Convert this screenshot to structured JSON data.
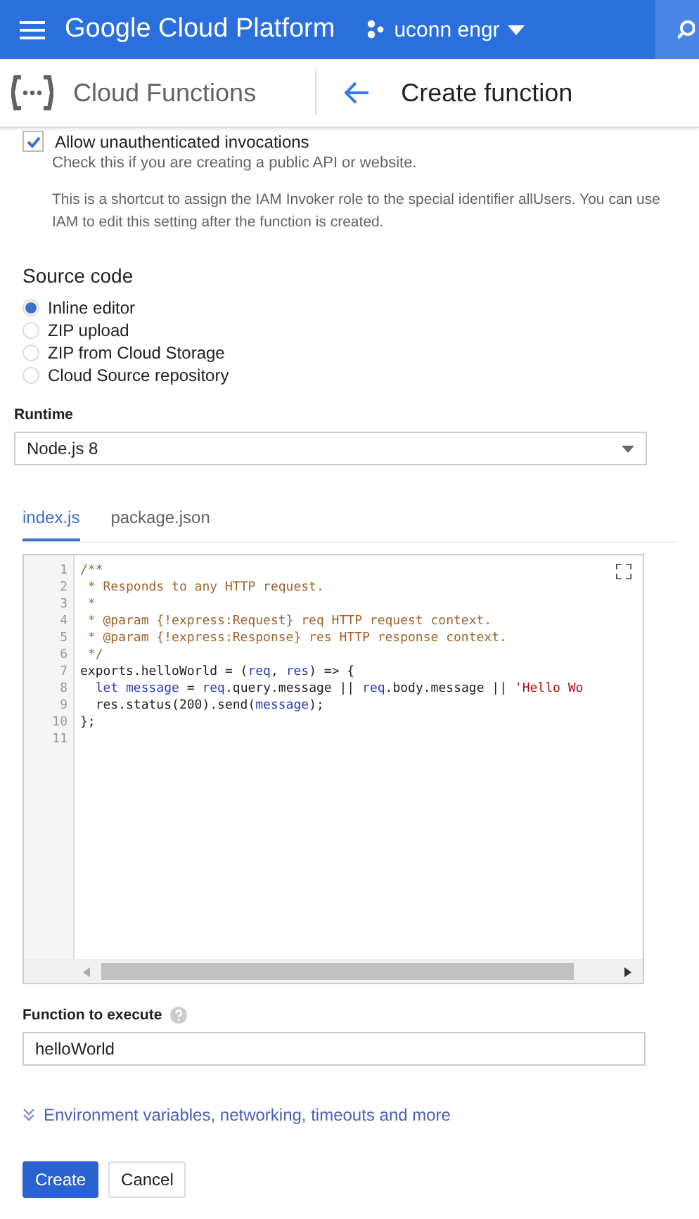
{
  "top_bar": {
    "title": "Google Cloud Platform",
    "project": "uconn engr"
  },
  "sub_header": {
    "product": "Cloud Functions",
    "page_title": "Create function"
  },
  "auth": {
    "label": "Allow unauthenticated invocations",
    "checked": true,
    "hint": "Check this if you are creating a public API or website.",
    "note": "This is a shortcut to assign the IAM Invoker role to the special identifier allUsers. You can use IAM to edit this setting after the function is created."
  },
  "source_code": {
    "title": "Source code",
    "options": [
      {
        "label": "Inline editor",
        "selected": true
      },
      {
        "label": "ZIP upload",
        "selected": false
      },
      {
        "label": "ZIP from Cloud Storage",
        "selected": false
      },
      {
        "label": "Cloud Source repository",
        "selected": false
      }
    ]
  },
  "runtime": {
    "label": "Runtime",
    "value": "Node.js 8"
  },
  "file_tabs": [
    {
      "label": "index.js",
      "selected": true
    },
    {
      "label": "package.json",
      "selected": false
    }
  ],
  "editor": {
    "lines": [
      {
        "number": "1",
        "tokens": [
          {
            "text": "/**",
            "kind": "comment"
          }
        ]
      },
      {
        "number": "2",
        "tokens": [
          {
            "text": " * Responds to any HTTP request.",
            "kind": "comment"
          }
        ]
      },
      {
        "number": "3",
        "tokens": [
          {
            "text": " *",
            "kind": "comment"
          }
        ]
      },
      {
        "number": "4",
        "tokens": [
          {
            "text": " * @param {!express:Request} req HTTP request context.",
            "kind": "comment"
          }
        ]
      },
      {
        "number": "5",
        "tokens": [
          {
            "text": " * @param {!express:Response} res HTTP response context.",
            "kind": "comment"
          }
        ]
      },
      {
        "number": "6",
        "tokens": [
          {
            "text": " */",
            "kind": "comment"
          }
        ]
      },
      {
        "number": "7",
        "tokens": [
          {
            "text": "exports.helloWorld = (",
            "kind": "plain"
          },
          {
            "text": "req",
            "kind": "variable"
          },
          {
            "text": ", ",
            "kind": "plain"
          },
          {
            "text": "res",
            "kind": "variable"
          },
          {
            "text": ") => {",
            "kind": "plain"
          }
        ]
      },
      {
        "number": "8",
        "tokens": [
          {
            "text": "  let message",
            "kind": "variable"
          },
          {
            "text": " = ",
            "kind": "plain"
          },
          {
            "text": "req",
            "kind": "variable"
          },
          {
            "text": ".query.message || ",
            "kind": "plain"
          },
          {
            "text": "req",
            "kind": "variable"
          },
          {
            "text": ".body.message || ",
            "kind": "plain"
          },
          {
            "text": "'Hello Wo",
            "kind": "string"
          }
        ]
      },
      {
        "number": "9",
        "tokens": [
          {
            "text": "  res.status(200).send(",
            "kind": "plain"
          },
          {
            "text": "message",
            "kind": "variable"
          },
          {
            "text": ");",
            "kind": "plain"
          }
        ]
      },
      {
        "number": "10",
        "tokens": [
          {
            "text": "};",
            "kind": "plain"
          }
        ]
      },
      {
        "number": "11"
      }
    ]
  },
  "function_to_execute": {
    "label": "Function to execute",
    "value": "helloWorld"
  },
  "more_link": "Environment variables, networking, timeouts and more",
  "buttons": [
    {
      "label": "Create",
      "kind": "primary"
    },
    {
      "label": "Cancel",
      "kind": "secondary"
    }
  ]
}
